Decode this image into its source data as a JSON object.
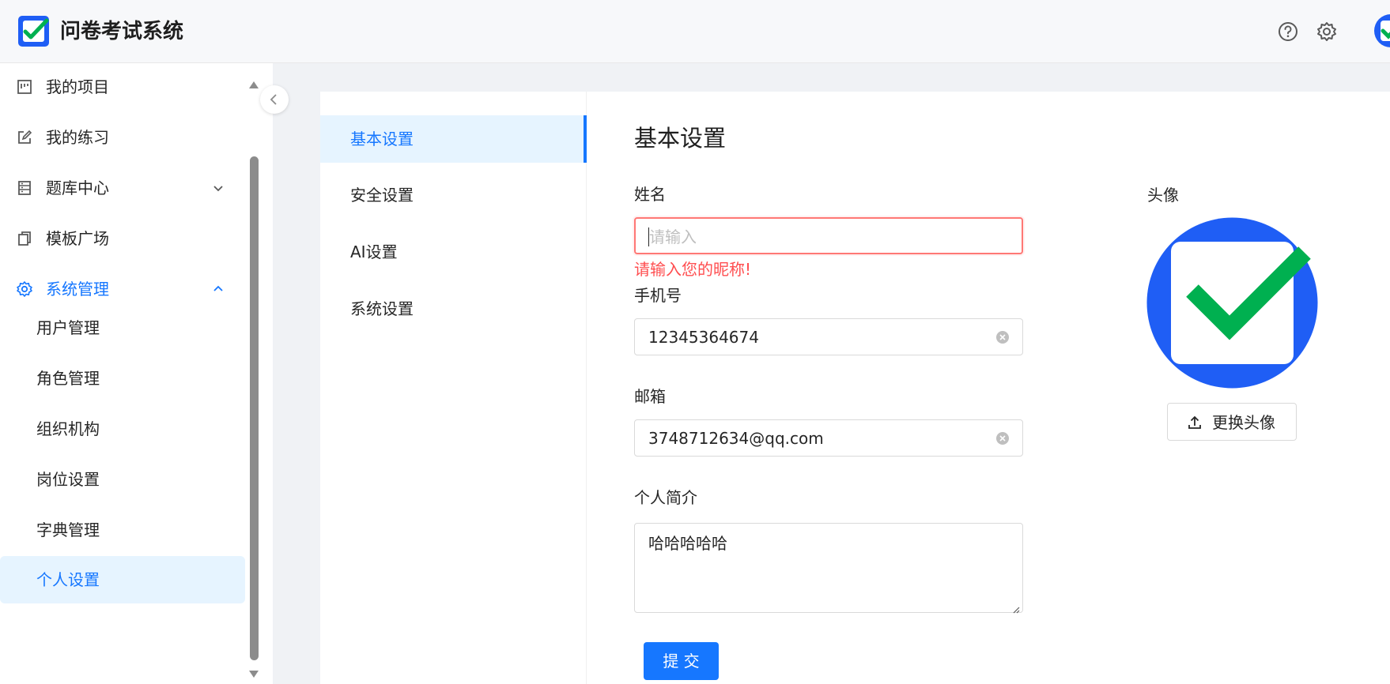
{
  "app": {
    "title": "问卷考试系统",
    "brand_color": "#1677ff",
    "check_color": "#00b050"
  },
  "header": {
    "help_icon": "question-circle-icon",
    "settings_icon": "gear-icon",
    "avatar": "user-avatar"
  },
  "sidebar": {
    "items": [
      {
        "label": "我的项目",
        "icon": "project-icon"
      },
      {
        "label": "我的练习",
        "icon": "edit-icon"
      },
      {
        "label": "题库中心",
        "icon": "database-icon",
        "arrow": "chevron-down-icon"
      },
      {
        "label": "模板广场",
        "icon": "copy-icon"
      },
      {
        "label": "系统管理",
        "icon": "gear-icon",
        "arrow": "chevron-up-icon",
        "expanded": true
      }
    ],
    "sub_items": [
      {
        "label": "用户管理"
      },
      {
        "label": "角色管理"
      },
      {
        "label": "组织机构"
      },
      {
        "label": "岗位设置"
      },
      {
        "label": "字典管理"
      },
      {
        "label": "个人设置",
        "selected": true
      }
    ]
  },
  "settings_nav": {
    "items": [
      {
        "label": "基本设置",
        "active": true
      },
      {
        "label": "安全设置"
      },
      {
        "label": "AI设置"
      },
      {
        "label": "系统设置"
      }
    ]
  },
  "form": {
    "title": "基本设置",
    "name_label": "姓名",
    "name_placeholder": "请输入",
    "name_value": "",
    "name_error": "请输入您的昵称!",
    "phone_label": "手机号",
    "phone_value": "12345364674",
    "email_label": "邮箱",
    "email_value": "3748712634@qq.com",
    "bio_label": "个人简介",
    "bio_value": "哈哈哈哈哈",
    "submit_label": "提 交"
  },
  "avatar_panel": {
    "label": "头像",
    "change_label": "更换头像",
    "upload_icon": "upload-icon"
  }
}
